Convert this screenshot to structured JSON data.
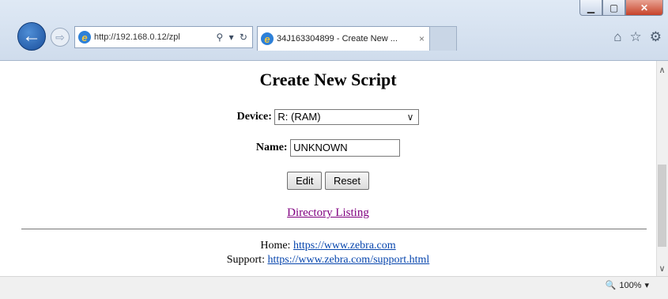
{
  "window": {
    "min_icon": "minimize-icon",
    "max_icon": "maximize-icon",
    "close_glyph": "✕"
  },
  "toolbar": {
    "back_glyph": "←",
    "forward_glyph": "⇨",
    "address_text": "http://192.168.0.12/zpl",
    "address_tools": "⚲ ▾ ↻",
    "tab_title": "34J163304899 - Create New ...",
    "tab_close": "×",
    "right_icons": [
      "⌂",
      "☆",
      "⚙"
    ]
  },
  "page": {
    "title": "Create New Script",
    "device_label": "Device:",
    "device_value": "R: (RAM)",
    "name_label": "Name:",
    "name_value": "UNKNOWN",
    "edit_label": "Edit",
    "reset_label": "Reset",
    "directory_link": "Directory Listing",
    "home_label": "Home:",
    "home_link": "https://www.zebra.com",
    "support_label": "Support:",
    "support_link": "https://www.zebra.com/support.html"
  },
  "status": {
    "zoom": "100%",
    "zoom_icon": "zoom-icon"
  }
}
